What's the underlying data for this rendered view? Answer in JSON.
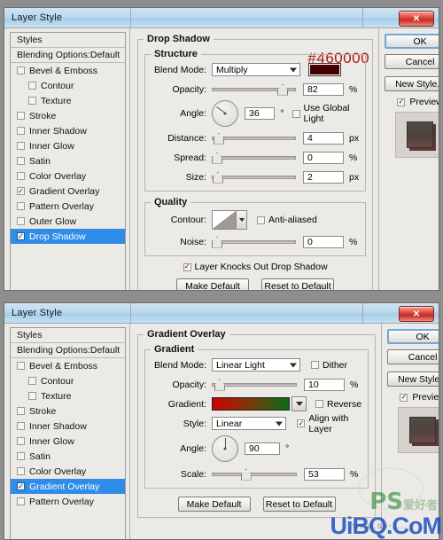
{
  "theme": {
    "accent": "#2f8ce8",
    "shadow_color_hex": "#460000",
    "gradient_from": "#cc0000",
    "gradient_to": "#0a6b16",
    "close_button_color": "#c62b20"
  },
  "annotation": {
    "hex_note": "#460000"
  },
  "dialog1": {
    "title": "Layer Style",
    "close_label": "✕",
    "styles_header": "Styles",
    "blending_header": "Blending Options:Default",
    "style_items": [
      {
        "label": "Bevel & Emboss",
        "checked": false,
        "indent": false,
        "selected": false
      },
      {
        "label": "Contour",
        "checked": false,
        "indent": true,
        "selected": false
      },
      {
        "label": "Texture",
        "checked": false,
        "indent": true,
        "selected": false
      },
      {
        "label": "Stroke",
        "checked": false,
        "indent": false,
        "selected": false
      },
      {
        "label": "Inner Shadow",
        "checked": false,
        "indent": false,
        "selected": false
      },
      {
        "label": "Inner Glow",
        "checked": false,
        "indent": false,
        "selected": false
      },
      {
        "label": "Satin",
        "checked": false,
        "indent": false,
        "selected": false
      },
      {
        "label": "Color Overlay",
        "checked": false,
        "indent": false,
        "selected": false
      },
      {
        "label": "Gradient Overlay",
        "checked": true,
        "indent": false,
        "selected": false
      },
      {
        "label": "Pattern Overlay",
        "checked": false,
        "indent": false,
        "selected": false
      },
      {
        "label": "Outer Glow",
        "checked": false,
        "indent": false,
        "selected": false
      },
      {
        "label": "Drop Shadow",
        "checked": true,
        "indent": false,
        "selected": true
      }
    ],
    "panel_title": "Drop Shadow",
    "structure": {
      "legend": "Structure",
      "blend_mode_label": "Blend Mode:",
      "blend_mode_value": "Multiply",
      "opacity_label": "Opacity:",
      "opacity_value": "82",
      "opacity_unit": "%",
      "angle_label": "Angle:",
      "angle_value": "36",
      "angle_unit": "°",
      "use_global_light": "Use Global Light",
      "use_global_light_checked": false,
      "distance_label": "Distance:",
      "distance_value": "4",
      "distance_unit": "px",
      "spread_label": "Spread:",
      "spread_value": "0",
      "spread_unit": "%",
      "size_label": "Size:",
      "size_value": "2",
      "size_unit": "px"
    },
    "quality": {
      "legend": "Quality",
      "contour_label": "Contour:",
      "anti_aliased": "Anti-aliased",
      "anti_aliased_checked": false,
      "noise_label": "Noise:",
      "noise_value": "0",
      "noise_unit": "%"
    },
    "knockout_label": "Layer Knocks Out Drop Shadow",
    "knockout_checked": true,
    "make_default": "Make Default",
    "reset_default": "Reset to Default",
    "ok": "OK",
    "cancel": "Cancel",
    "new_style": "New Style...",
    "preview_label": "Preview",
    "preview_checked": true
  },
  "dialog2": {
    "title": "Layer Style",
    "close_label": "✕",
    "styles_header": "Styles",
    "blending_header": "Blending Options:Default",
    "style_items": [
      {
        "label": "Bevel & Emboss",
        "checked": false,
        "indent": false,
        "selected": false
      },
      {
        "label": "Contour",
        "checked": false,
        "indent": true,
        "selected": false
      },
      {
        "label": "Texture",
        "checked": false,
        "indent": true,
        "selected": false
      },
      {
        "label": "Stroke",
        "checked": false,
        "indent": false,
        "selected": false
      },
      {
        "label": "Inner Shadow",
        "checked": false,
        "indent": false,
        "selected": false
      },
      {
        "label": "Inner Glow",
        "checked": false,
        "indent": false,
        "selected": false
      },
      {
        "label": "Satin",
        "checked": false,
        "indent": false,
        "selected": false
      },
      {
        "label": "Color Overlay",
        "checked": false,
        "indent": false,
        "selected": false
      },
      {
        "label": "Gradient Overlay",
        "checked": true,
        "indent": false,
        "selected": true
      },
      {
        "label": "Pattern Overlay",
        "checked": false,
        "indent": false,
        "selected": false
      }
    ],
    "panel_title": "Gradient Overlay",
    "gradient": {
      "legend": "Gradient",
      "blend_mode_label": "Blend Mode:",
      "blend_mode_value": "Linear Light",
      "dither_label": "Dither",
      "dither_checked": false,
      "opacity_label": "Opacity:",
      "opacity_value": "10",
      "opacity_unit": "%",
      "gradient_label": "Gradient:",
      "reverse_label": "Reverse",
      "reverse_checked": false,
      "style_label": "Style:",
      "style_value": "Linear",
      "align_label": "Align with Layer",
      "align_checked": true,
      "angle_label": "Angle:",
      "angle_value": "90",
      "angle_unit": "°",
      "scale_label": "Scale:",
      "scale_value": "53",
      "scale_unit": "%"
    },
    "make_default": "Make Default",
    "reset_default": "Reset to Default",
    "ok": "OK",
    "cancel": "Cancel",
    "new_style": "New Style...",
    "preview_label": "Preview",
    "preview_checked": true
  },
  "watermarks": {
    "green_main": "PS",
    "green_sub": "爱好者",
    "blue": "UiBQ.CoM",
    "faint": "www.sa-z..."
  }
}
